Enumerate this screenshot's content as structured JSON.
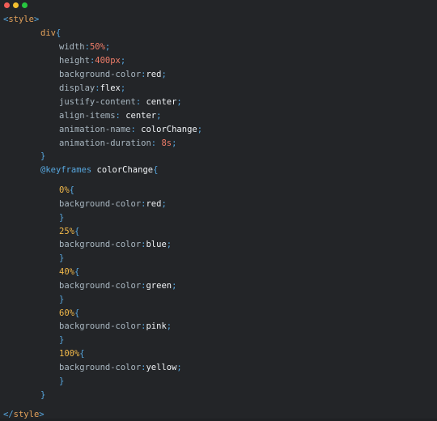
{
  "window": {
    "controls": [
      "close",
      "minimize",
      "maximize"
    ]
  },
  "code": {
    "style_open": "style",
    "selector": "div",
    "brace_open": "{",
    "brace_close": "}",
    "properties": [
      {
        "prop": "width",
        "value": "50%"
      },
      {
        "prop": "height",
        "value": "400px"
      },
      {
        "prop": "background-color",
        "value": "red"
      },
      {
        "prop": "display",
        "value": "flex"
      },
      {
        "prop": "justify-content",
        "value": "center"
      },
      {
        "prop": "align-items",
        "value": "center"
      },
      {
        "prop": "animation-name",
        "value": "colorChange"
      },
      {
        "prop": "animation-duration",
        "value": "8s"
      }
    ],
    "keyframes_at": "@keyframes",
    "keyframes_name": "colorChange",
    "keyframes": [
      {
        "stop": "0%",
        "prop": "background-color",
        "value": "red"
      },
      {
        "stop": "25%",
        "prop": "background-color",
        "value": "blue"
      },
      {
        "stop": "40%",
        "prop": "background-color",
        "value": "green"
      },
      {
        "stop": "60%",
        "prop": "background-color",
        "value": "pink"
      },
      {
        "stop": "100%",
        "prop": "background-color",
        "value": "yellow"
      }
    ],
    "style_close": "style"
  }
}
